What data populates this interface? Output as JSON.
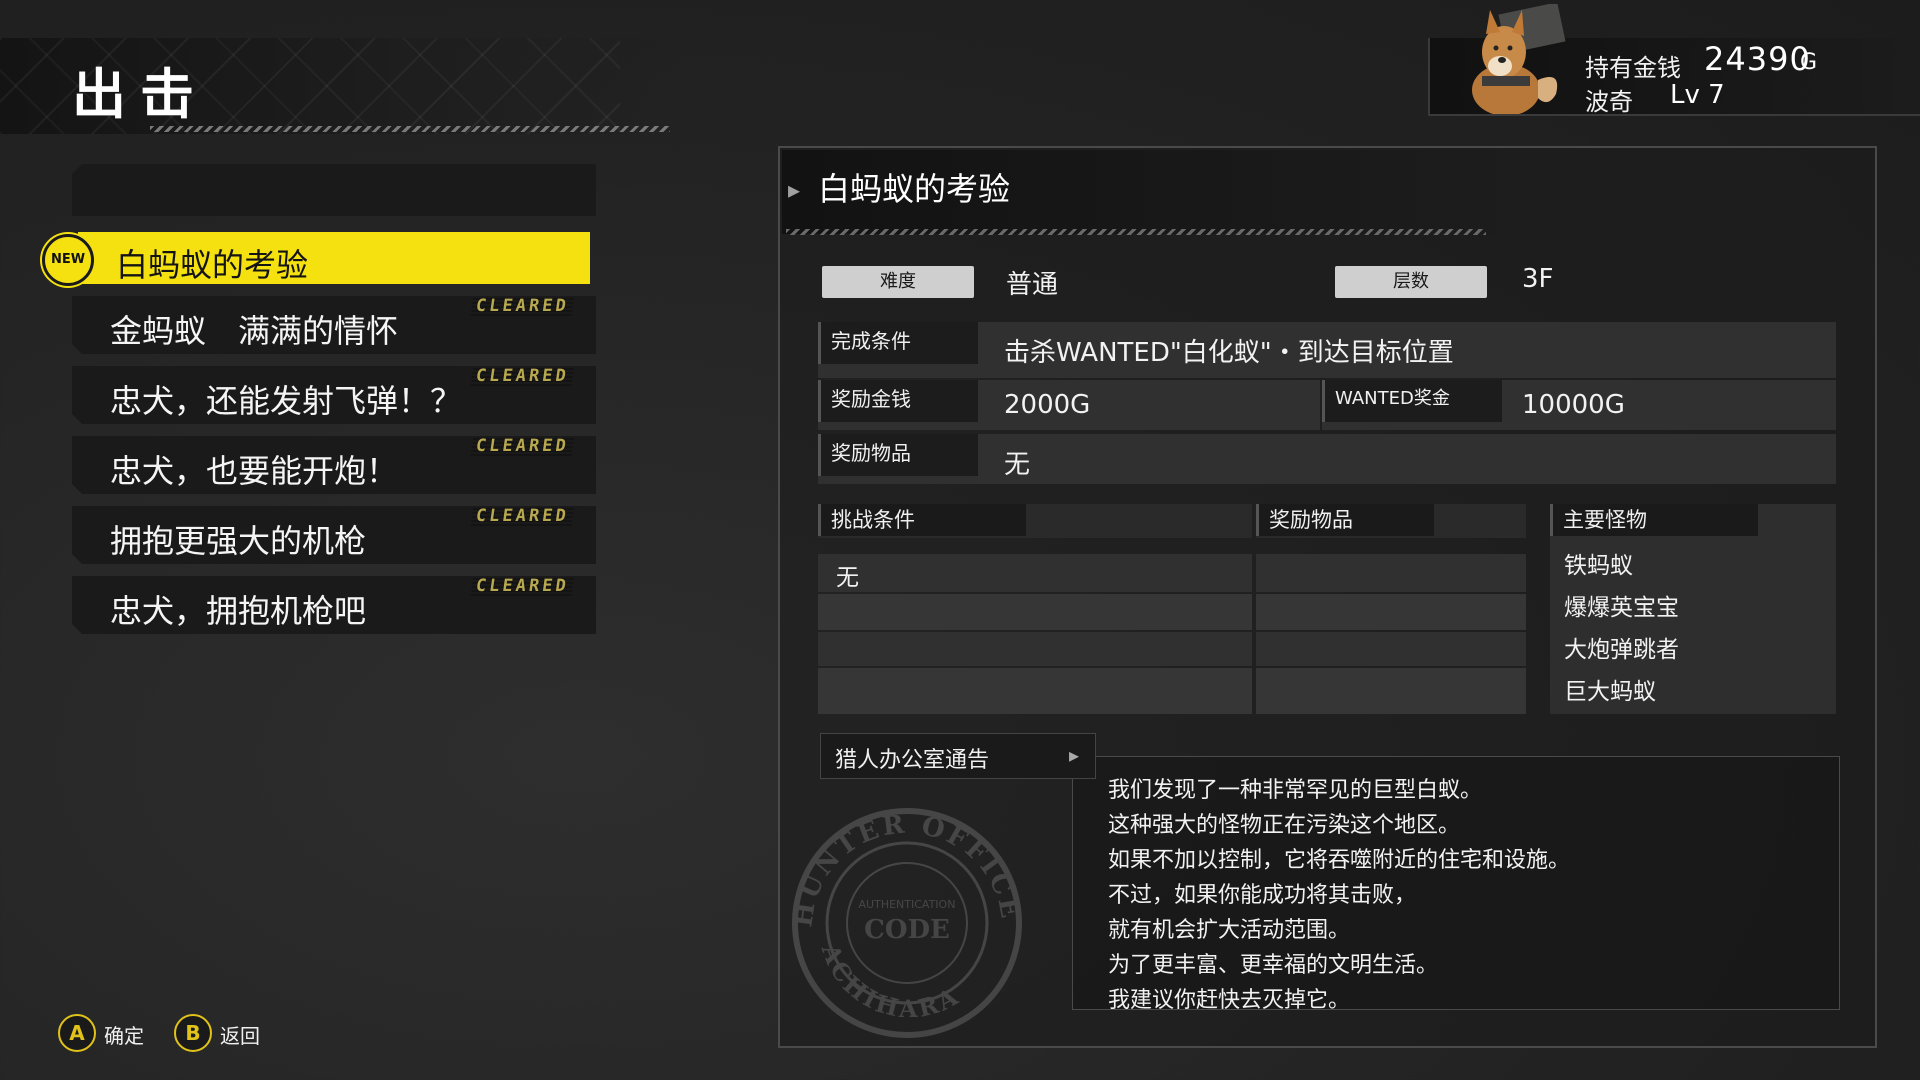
{
  "header": {
    "title": "出击"
  },
  "status": {
    "money_label": "持有金钱",
    "money_value": "24390",
    "money_unit": "G",
    "pet_name": "波奇",
    "pet_level": "Lv 7"
  },
  "missions": [
    {
      "label": "白蚂蚁的考验",
      "badge": "NEW",
      "cleared": ""
    },
    {
      "label": "金蚂蚁　满满的情怀",
      "badge": "",
      "cleared": "CLEARED"
    },
    {
      "label": "忠犬，还能发射飞弹！？",
      "badge": "",
      "cleared": "CLEARED"
    },
    {
      "label": "忠犬，也要能开炮！",
      "badge": "",
      "cleared": "CLEARED"
    },
    {
      "label": "拥抱更强大的机枪",
      "badge": "",
      "cleared": "CLEARED"
    },
    {
      "label": "忠犬，拥抱机枪吧",
      "badge": "",
      "cleared": "CLEARED"
    }
  ],
  "detail": {
    "title": "白蚂蚁的考验",
    "difficulty_label": "难度",
    "difficulty_value": "普通",
    "floors_label": "层数",
    "floors_value": "3F",
    "completion_label": "完成条件",
    "completion_value": "击杀WANTED\"白化蚁\"・到达目标位置",
    "reward_money_label": "奖励金钱",
    "reward_money_value": "2000G",
    "wanted_bounty_label": "WANTED奖金",
    "wanted_bounty_value": "10000G",
    "reward_items_label": "奖励物品",
    "reward_items_value": "无",
    "challenge_header": "挑战条件",
    "challenge_items_header": "奖励物品",
    "monsters_header": "主要怪物",
    "challenge_values": [
      "无"
    ],
    "monsters": [
      "铁蚂蚁",
      "爆爆英宝宝",
      "大炮弹跳者",
      "巨大蚂蚁"
    ]
  },
  "notice": {
    "tab_label": "猎人办公室通告",
    "lines": [
      "我们发现了一种非常罕见的巨型白蚁。",
      "这种强大的怪物正在污染这个地区。",
      "如果不加以控制，它将吞噬附近的住宅和设施。",
      "不过，如果你能成功将其击败，",
      "就有机会扩大活动范围。",
      "为了更丰富、更幸福的文明生活。",
      "我建议你赶快去灭掉它。"
    ],
    "stamp_text_top": "HUNTER OFFICE",
    "stamp_text_mid": "AUTHENTICATION",
    "stamp_text_code": "CODE",
    "stamp_text_bottom": "ACHIHARA"
  },
  "footer": {
    "confirm_key": "A",
    "confirm_label": "确定",
    "back_key": "B",
    "back_label": "返回"
  },
  "colors": {
    "accent_yellow": "#f5e110",
    "cleared_gold": "#b8a850",
    "panel_dark": "#1a1a1a"
  }
}
